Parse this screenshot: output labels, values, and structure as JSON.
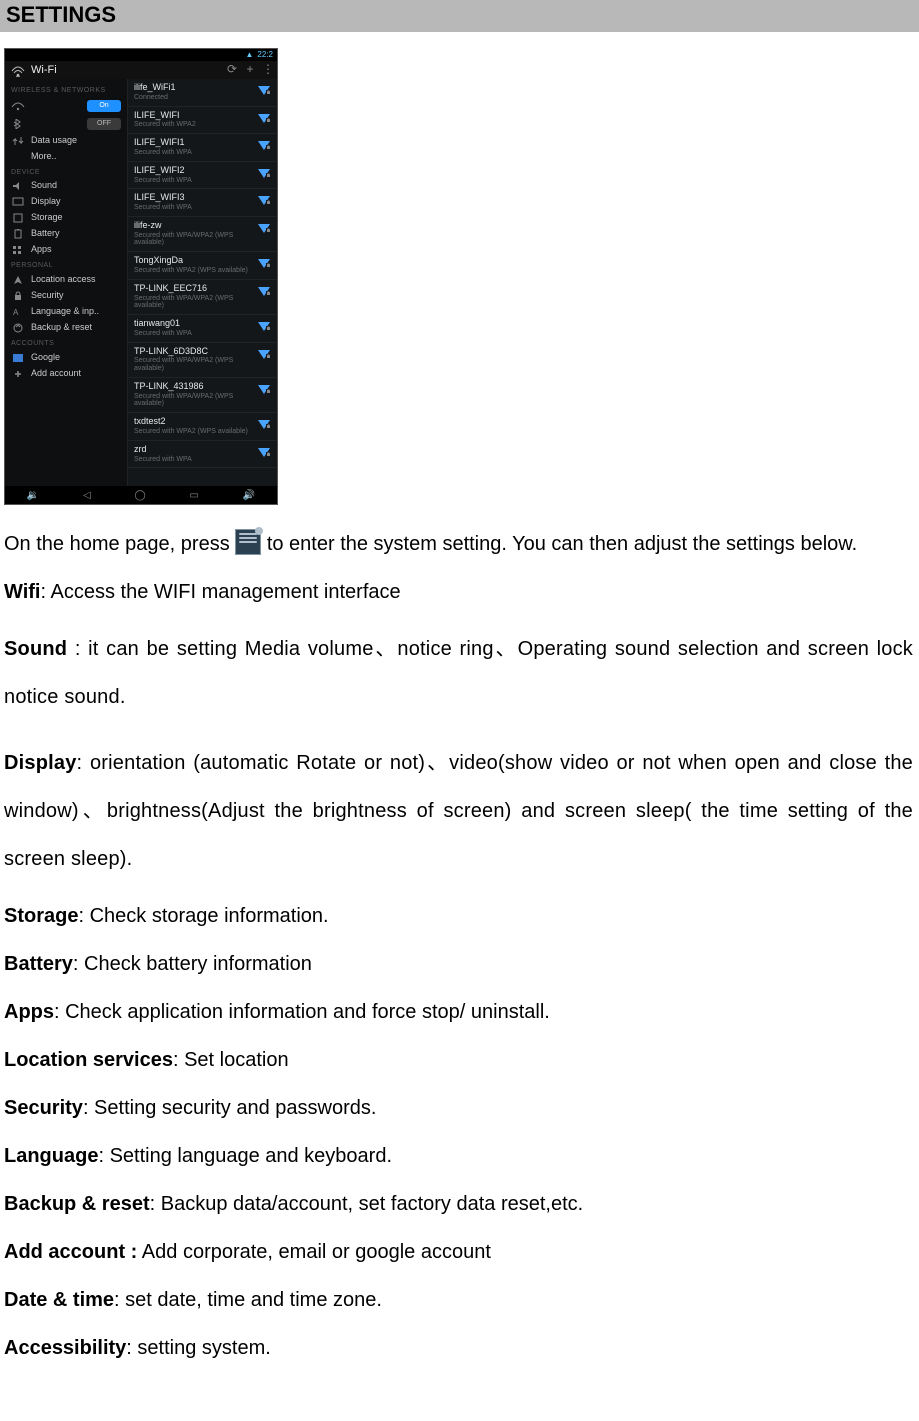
{
  "heading": "SETTINGS",
  "intro": {
    "pre": "On the home page, press ",
    "icon_name": "settings-icon",
    "post": " to enter the system setting. You can then adjust the settings below."
  },
  "items": [
    {
      "label": "Wifi",
      "desc": ": Access the WIFI management interface"
    },
    {
      "label": "Sound ",
      "desc": ": it can be setting Media volume、notice ring、Operating sound selection and screen lock notice sound.",
      "wide": true
    },
    {
      "label": "Display",
      "desc": ": orientation (automatic Rotate or not)、video(show video or not when open and close the window)、brightness(Adjust the brightness of screen) and screen sleep( the time setting of the screen sleep).",
      "wide": true
    },
    {
      "label": "Storage",
      "desc": ": Check storage information."
    },
    {
      "label": "Battery",
      "desc": ": Check battery information"
    },
    {
      "label": "Apps",
      "desc": ": Check application information and force stop/ uninstall."
    },
    {
      "label": "Location services",
      "desc": ": Set location"
    },
    {
      "label": "Security",
      "desc": ": Setting security and passwords."
    },
    {
      "label": "Language",
      "desc": ": Setting language and keyboard."
    },
    {
      "label": "Backup & reset",
      "desc": ": Backup data/account, set factory data reset,etc."
    },
    {
      "label": "Add account :",
      "desc": " Add corporate, email or google account"
    },
    {
      "label": "Date & time",
      "desc": ": set date, time and time zone."
    },
    {
      "label": "Accessibility",
      "desc": ": setting system."
    }
  ],
  "screenshot": {
    "status_time": "22:2",
    "title": "Wi-Fi",
    "categories": {
      "c1": "WIRELESS & NETWORKS",
      "c2": "DEVICE",
      "c3": "PERSONAL",
      "c4": "ACCOUNTS"
    },
    "left": [
      {
        "icon": "wifi",
        "label": "",
        "toggle": "On"
      },
      {
        "icon": "bt",
        "label": "",
        "toggle": "OFF"
      },
      {
        "icon": "data",
        "label": "Data usage"
      },
      {
        "icon": "more",
        "label": "More.."
      },
      {
        "cat": "c2"
      },
      {
        "icon": "sound",
        "label": "Sound"
      },
      {
        "icon": "display",
        "label": "Display"
      },
      {
        "icon": "storage",
        "label": "Storage"
      },
      {
        "icon": "battery",
        "label": "Battery"
      },
      {
        "icon": "apps",
        "label": "Apps"
      },
      {
        "cat": "c3"
      },
      {
        "icon": "location",
        "label": "Location access"
      },
      {
        "icon": "security",
        "label": "Security"
      },
      {
        "icon": "lang",
        "label": "Language & inp.."
      },
      {
        "icon": "backup",
        "label": "Backup & reset"
      },
      {
        "cat": "c4"
      },
      {
        "icon": "google",
        "label": "Google"
      },
      {
        "icon": "add",
        "label": "Add account"
      }
    ],
    "networks": [
      {
        "name": "ilife_WiFi1",
        "sub": "Connected"
      },
      {
        "name": "ILIFE_WIFI",
        "sub": "Secured with WPA2"
      },
      {
        "name": "ILIFE_WIFI1",
        "sub": "Secured with WPA"
      },
      {
        "name": "ILIFE_WIFI2",
        "sub": "Secured with WPA"
      },
      {
        "name": "ILIFE_WIFI3",
        "sub": "Secured with WPA"
      },
      {
        "name": "ilife-zw",
        "sub": "Secured with WPA/WPA2 (WPS available)"
      },
      {
        "name": "TongXingDa",
        "sub": "Secured with WPA2 (WPS available)"
      },
      {
        "name": "TP-LINK_EEC716",
        "sub": "Secured with WPA/WPA2 (WPS available)"
      },
      {
        "name": "tianwang01",
        "sub": "Secured with WPA"
      },
      {
        "name": "TP-LINK_6D3D8C",
        "sub": "Secured with WPA/WPA2 (WPS available)"
      },
      {
        "name": "TP-LINK_431986",
        "sub": "Secured with WPA/WPA2 (WPS available)"
      },
      {
        "name": "txdtest2",
        "sub": "Secured with WPA2 (WPS available)"
      },
      {
        "name": "zrd",
        "sub": "Secured with WPA"
      }
    ],
    "nav": {
      "back": "◁",
      "home": "◯",
      "sound1": "🔉",
      "recent": "▭",
      "sound2": "🔊"
    }
  }
}
